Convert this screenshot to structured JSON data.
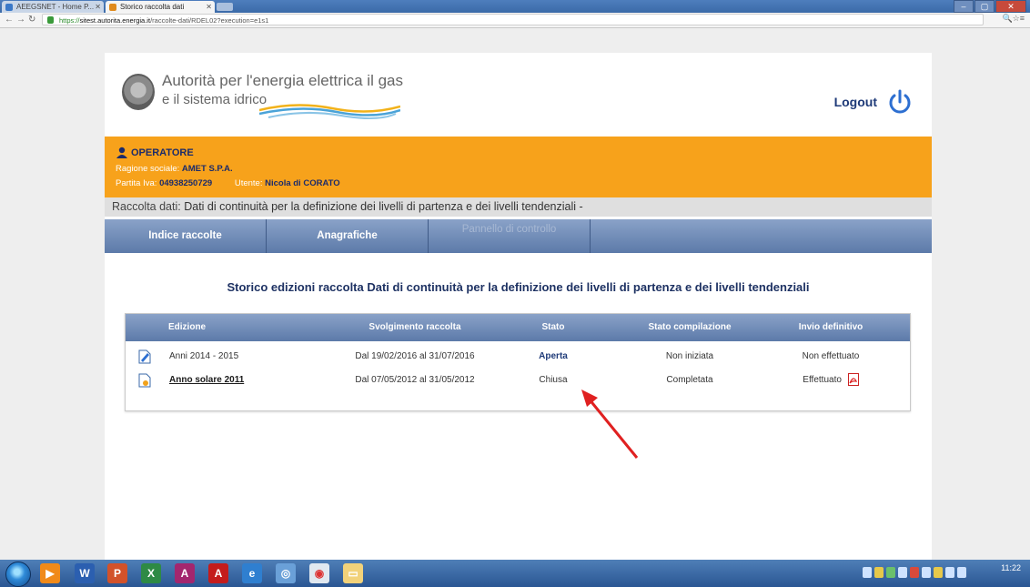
{
  "browser": {
    "tabs": [
      {
        "label": "AEEGSNET - Home P...",
        "active": false
      },
      {
        "label": "Storico raccolta dati",
        "active": true
      }
    ],
    "url": {
      "scheme": "https://",
      "host": "sitest.autorita.energia.it",
      "path": "/raccolte-dati/RDEL02?execution=e1s1"
    }
  },
  "header": {
    "org_line1": "Autorità per l'energia elettrica il gas",
    "org_line2": "e il sistema idrico",
    "logout_label": "Logout"
  },
  "operator": {
    "title": "OPERATORE",
    "ragione_label": "Ragione sociale:",
    "ragione_value": "AMET S.P.A.",
    "piva_label": "Partita Iva:",
    "piva_value": "04938250729",
    "utente_label": "Utente:",
    "utente_value": "Nicola di CORATO"
  },
  "raccolta": {
    "label": "Raccolta dati:",
    "value": "Dati di continuità per la definizione dei livelli di partenza e dei livelli tendenziali -"
  },
  "nav": {
    "items": [
      {
        "label": "Indice raccolte"
      },
      {
        "label": "Anagrafiche"
      },
      {
        "label": "Pannello di controllo"
      }
    ]
  },
  "main": {
    "title": "Storico edizioni raccolta Dati di continuità per la definizione dei livelli di partenza e dei livelli tendenziali",
    "table": {
      "headers": [
        "Edizione",
        "Svolgimento raccolta",
        "Stato",
        "Stato compilazione",
        "Invio definitivo"
      ],
      "rows": [
        {
          "edizione": "Anni 2014 - 2015",
          "svolgimento": "Dal 19/02/2016 al 31/07/2016",
          "stato": "Aperta",
          "compilazione": "Non iniziata",
          "invio": "Non effettuato"
        },
        {
          "edizione": "Anno solare 2011",
          "svolgimento": "Dal 07/05/2012 al 31/05/2012",
          "stato": "Chiusa",
          "compilazione": "Completata",
          "invio": "Effettuato"
        }
      ]
    }
  },
  "taskbar": {
    "clock": "11:22"
  },
  "colors": {
    "operator_bar": "#f7a21b",
    "nav_bar": "#5c7aa9",
    "title_blue": "#1e3263",
    "annotation_arrow": "#e02020"
  }
}
